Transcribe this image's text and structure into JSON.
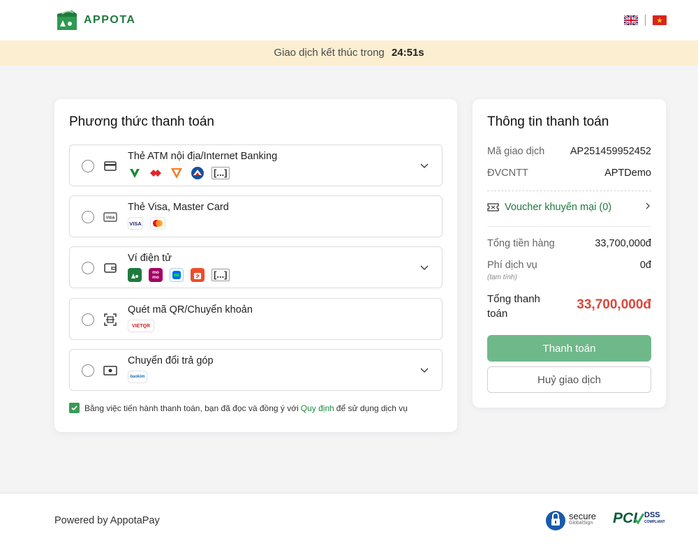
{
  "header": {
    "brand": "APPOTA",
    "languages": [
      "English",
      "Tiếng Việt"
    ]
  },
  "timer": {
    "label": "Giao dịch kết thúc trong",
    "value": "24:51s"
  },
  "payment_methods": {
    "title": "Phương thức thanh toán",
    "items": [
      {
        "label": "Thẻ ATM nội địa/Internet Banking",
        "expandable": true,
        "more": "[...]"
      },
      {
        "label": "Thẻ Visa, Master Card",
        "expandable": false,
        "visa": "VISA"
      },
      {
        "label": "Ví điện tử",
        "expandable": true,
        "more": "[...]",
        "momo": "mo mo"
      },
      {
        "label": "Quét mã QR/Chuyển khoản",
        "expandable": false,
        "vietqr": "VIETQR"
      },
      {
        "label": "Chuyển đổi trả góp",
        "expandable": true,
        "baokim": "baokim"
      }
    ],
    "agreement": {
      "checked": true,
      "prefix": "Bằng việc tiến hành thanh toán, bạn đã đọc và đồng ý với",
      "link": "Quy định",
      "suffix": "để sử dụng dịch vụ"
    }
  },
  "payment_info": {
    "title": "Thông tin thanh toán",
    "transaction_id_label": "Mã giao dịch",
    "transaction_id": "AP251459952452",
    "merchant_label": "ĐVCNTT",
    "merchant": "APTDemo",
    "voucher_label": "Voucher khuyến mại (0)",
    "subtotal_label": "Tổng tiền hàng",
    "subtotal": "33,700,000đ",
    "fee_label": "Phí dịch vụ",
    "fee_note": "(tạm tính)",
    "fee": "0đ",
    "total_label": "Tổng thanh toán",
    "total": "33,700,000đ",
    "pay_button": "Thanh toán",
    "cancel_button": "Huỷ giao dịch"
  },
  "footer": {
    "powered_by": "Powered by AppotaPay",
    "secure_badge": "secure",
    "secure_sub": "GlobalSign",
    "pci": "PCI",
    "dss": "DSS",
    "dss_sub": "COMPLIANT"
  },
  "colors": {
    "brand_green": "#1f7a3d",
    "pay_button": "#6fb88a",
    "total_red": "#d9473a",
    "timer_bg": "#fbeed1"
  }
}
